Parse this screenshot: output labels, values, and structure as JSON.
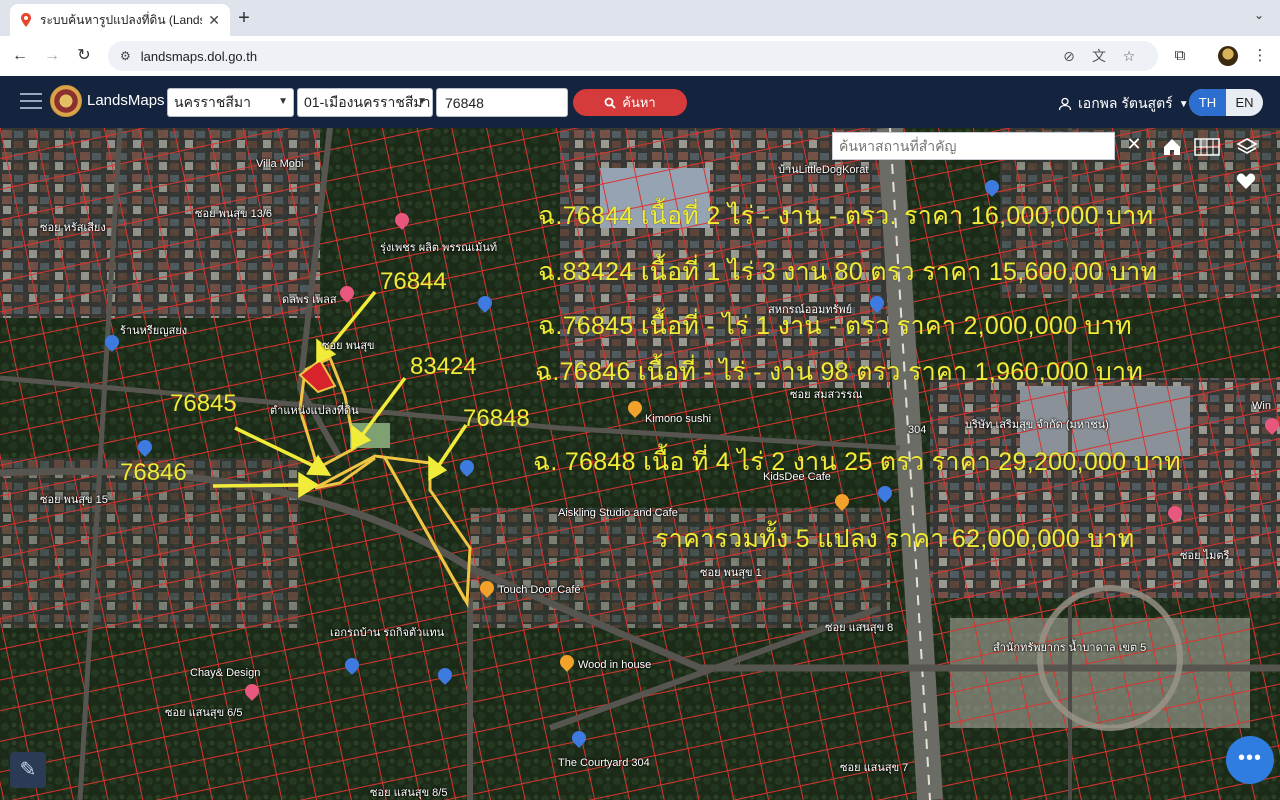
{
  "browser": {
    "tab_title": "ระบบค้นหารูปแปลงที่ดิน (LandsMaps)",
    "url": "landsmaps.dol.go.th"
  },
  "app": {
    "brand": "LandsMaps",
    "province": "นครราชสีมา",
    "district": "01-เมืองนครราชสีมา",
    "parcel_number": "76848",
    "search_label": "ค้นหา",
    "user_name": "เอกพล รัตนสูตร์",
    "lang_th": "TH",
    "lang_en": "EN",
    "place_search_placeholder": "ค้นหาสถานที่สำคัญ"
  },
  "annotations": {
    "lines": [
      "ฉ.76844 เนื้อที่ 2 ไร่  - งาน - ตรว. ราคา 16,000,000 บาท",
      "ฉ.83424 เนื้อที่ 1 ไร่ 3 งาน 80 ตรว ราคา  15,600,00 บาท",
      "ฉ.76845 เนื้อที่ - ไร่  1 งาน - ตรว  ราคา 2,000,000 บาท",
      "ฉ.76846 เนื้อที่ - ไร่ - งาน 98 ตรว  ราคา 1,960,000  บาท",
      "ฉ. 76848 เนื้อ ที่  4 ไร่ 2 งาน 25 ตรว ราคา  29,200,000 บาท",
      "ราคารวมทั้ง 5 แปลง ราคา 62,000,000 บาท"
    ],
    "parcel_labels": [
      "76844",
      "83424",
      "76845",
      "76848",
      "76846"
    ]
  },
  "map_labels": {
    "villa": "Villa Mobi",
    "soi_phonsuk_13_6": "ซอย พนสุข 13/6",
    "soi_hor_jeng": "ซอย หรัสเสียง",
    "rung_phet": "รุ่งเพชร ผลิต\nพรรณเม้นท์",
    "dol_pet": "ดลพร เพลส",
    "ran_hriyn": "ร้านหรียญสยง",
    "soi_phonsuk": "ซอย พนสุข",
    "parcel_pos": "ตำแหน่งแปลงที่ดิน",
    "kimono": "Kimono sushi",
    "kidsdee": "KidsDee Cafe",
    "aiskling": "Aiskling Studio and Cafe",
    "touch_door": "Touch Door Café",
    "wood_in_house": "Wood in house",
    "chay_design": "Chay& Design",
    "courtyard": "The Courtyard 304",
    "soi_somsawan": "ซอย สมสวรรณ",
    "soi_phonsuk_1": "ซอย พนสุข 1",
    "soi_maitri": "ซอย ไมตรี",
    "soi_saensuk_8": "ซอย แสนสุข 8",
    "soi_saensuk_6_5": "ซอย แสนสุข 6/5",
    "soi_saensuk_8_5": "ซอย แสนสุข 8/5",
    "soi_saensuk_7": "ซอย แสนสุข 7",
    "rd_304": "304",
    "little_dog": "บ้านLittleDogKorat",
    "win": "Win",
    "office_tax": "สำนักทรัพยากร\nน้ำบาดาล เขต 5",
    "bsc": "บริษัท เสริมสุข\nจำกัด (มหาชน)",
    "sahakorn": "สหกรณ์ออมทรัพย์",
    "ekkarat": "เอกรถบ้าน\nรถกิจตัวแทน",
    "soi_phonsuk_15": "ซอย พนสุข 15"
  }
}
